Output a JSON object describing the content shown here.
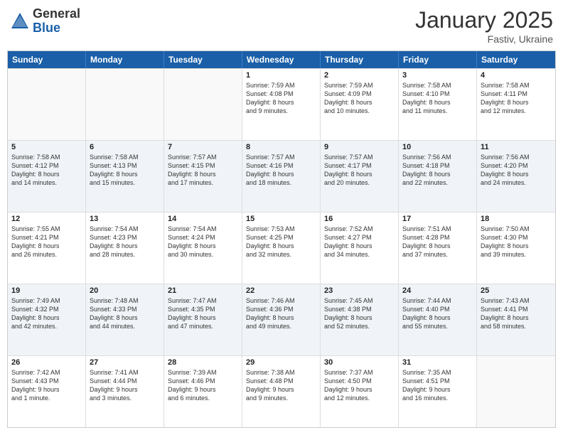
{
  "logo": {
    "general": "General",
    "blue": "Blue"
  },
  "title": "January 2025",
  "location": "Fastiv, Ukraine",
  "header_days": [
    "Sunday",
    "Monday",
    "Tuesday",
    "Wednesday",
    "Thursday",
    "Friday",
    "Saturday"
  ],
  "rows": [
    [
      {
        "day": "",
        "lines": [],
        "empty": true
      },
      {
        "day": "",
        "lines": [],
        "empty": true
      },
      {
        "day": "",
        "lines": [],
        "empty": true
      },
      {
        "day": "1",
        "lines": [
          "Sunrise: 7:59 AM",
          "Sunset: 4:08 PM",
          "Daylight: 8 hours",
          "and 9 minutes."
        ],
        "empty": false
      },
      {
        "day": "2",
        "lines": [
          "Sunrise: 7:59 AM",
          "Sunset: 4:09 PM",
          "Daylight: 8 hours",
          "and 10 minutes."
        ],
        "empty": false
      },
      {
        "day": "3",
        "lines": [
          "Sunrise: 7:58 AM",
          "Sunset: 4:10 PM",
          "Daylight: 8 hours",
          "and 11 minutes."
        ],
        "empty": false
      },
      {
        "day": "4",
        "lines": [
          "Sunrise: 7:58 AM",
          "Sunset: 4:11 PM",
          "Daylight: 8 hours",
          "and 12 minutes."
        ],
        "empty": false
      }
    ],
    [
      {
        "day": "5",
        "lines": [
          "Sunrise: 7:58 AM",
          "Sunset: 4:12 PM",
          "Daylight: 8 hours",
          "and 14 minutes."
        ],
        "empty": false
      },
      {
        "day": "6",
        "lines": [
          "Sunrise: 7:58 AM",
          "Sunset: 4:13 PM",
          "Daylight: 8 hours",
          "and 15 minutes."
        ],
        "empty": false
      },
      {
        "day": "7",
        "lines": [
          "Sunrise: 7:57 AM",
          "Sunset: 4:15 PM",
          "Daylight: 8 hours",
          "and 17 minutes."
        ],
        "empty": false
      },
      {
        "day": "8",
        "lines": [
          "Sunrise: 7:57 AM",
          "Sunset: 4:16 PM",
          "Daylight: 8 hours",
          "and 18 minutes."
        ],
        "empty": false
      },
      {
        "day": "9",
        "lines": [
          "Sunrise: 7:57 AM",
          "Sunset: 4:17 PM",
          "Daylight: 8 hours",
          "and 20 minutes."
        ],
        "empty": false
      },
      {
        "day": "10",
        "lines": [
          "Sunrise: 7:56 AM",
          "Sunset: 4:18 PM",
          "Daylight: 8 hours",
          "and 22 minutes."
        ],
        "empty": false
      },
      {
        "day": "11",
        "lines": [
          "Sunrise: 7:56 AM",
          "Sunset: 4:20 PM",
          "Daylight: 8 hours",
          "and 24 minutes."
        ],
        "empty": false
      }
    ],
    [
      {
        "day": "12",
        "lines": [
          "Sunrise: 7:55 AM",
          "Sunset: 4:21 PM",
          "Daylight: 8 hours",
          "and 26 minutes."
        ],
        "empty": false
      },
      {
        "day": "13",
        "lines": [
          "Sunrise: 7:54 AM",
          "Sunset: 4:23 PM",
          "Daylight: 8 hours",
          "and 28 minutes."
        ],
        "empty": false
      },
      {
        "day": "14",
        "lines": [
          "Sunrise: 7:54 AM",
          "Sunset: 4:24 PM",
          "Daylight: 8 hours",
          "and 30 minutes."
        ],
        "empty": false
      },
      {
        "day": "15",
        "lines": [
          "Sunrise: 7:53 AM",
          "Sunset: 4:25 PM",
          "Daylight: 8 hours",
          "and 32 minutes."
        ],
        "empty": false
      },
      {
        "day": "16",
        "lines": [
          "Sunrise: 7:52 AM",
          "Sunset: 4:27 PM",
          "Daylight: 8 hours",
          "and 34 minutes."
        ],
        "empty": false
      },
      {
        "day": "17",
        "lines": [
          "Sunrise: 7:51 AM",
          "Sunset: 4:28 PM",
          "Daylight: 8 hours",
          "and 37 minutes."
        ],
        "empty": false
      },
      {
        "day": "18",
        "lines": [
          "Sunrise: 7:50 AM",
          "Sunset: 4:30 PM",
          "Daylight: 8 hours",
          "and 39 minutes."
        ],
        "empty": false
      }
    ],
    [
      {
        "day": "19",
        "lines": [
          "Sunrise: 7:49 AM",
          "Sunset: 4:32 PM",
          "Daylight: 8 hours",
          "and 42 minutes."
        ],
        "empty": false
      },
      {
        "day": "20",
        "lines": [
          "Sunrise: 7:48 AM",
          "Sunset: 4:33 PM",
          "Daylight: 8 hours",
          "and 44 minutes."
        ],
        "empty": false
      },
      {
        "day": "21",
        "lines": [
          "Sunrise: 7:47 AM",
          "Sunset: 4:35 PM",
          "Daylight: 8 hours",
          "and 47 minutes."
        ],
        "empty": false
      },
      {
        "day": "22",
        "lines": [
          "Sunrise: 7:46 AM",
          "Sunset: 4:36 PM",
          "Daylight: 8 hours",
          "and 49 minutes."
        ],
        "empty": false
      },
      {
        "day": "23",
        "lines": [
          "Sunrise: 7:45 AM",
          "Sunset: 4:38 PM",
          "Daylight: 8 hours",
          "and 52 minutes."
        ],
        "empty": false
      },
      {
        "day": "24",
        "lines": [
          "Sunrise: 7:44 AM",
          "Sunset: 4:40 PM",
          "Daylight: 8 hours",
          "and 55 minutes."
        ],
        "empty": false
      },
      {
        "day": "25",
        "lines": [
          "Sunrise: 7:43 AM",
          "Sunset: 4:41 PM",
          "Daylight: 8 hours",
          "and 58 minutes."
        ],
        "empty": false
      }
    ],
    [
      {
        "day": "26",
        "lines": [
          "Sunrise: 7:42 AM",
          "Sunset: 4:43 PM",
          "Daylight: 9 hours",
          "and 1 minute."
        ],
        "empty": false
      },
      {
        "day": "27",
        "lines": [
          "Sunrise: 7:41 AM",
          "Sunset: 4:44 PM",
          "Daylight: 9 hours",
          "and 3 minutes."
        ],
        "empty": false
      },
      {
        "day": "28",
        "lines": [
          "Sunrise: 7:39 AM",
          "Sunset: 4:46 PM",
          "Daylight: 9 hours",
          "and 6 minutes."
        ],
        "empty": false
      },
      {
        "day": "29",
        "lines": [
          "Sunrise: 7:38 AM",
          "Sunset: 4:48 PM",
          "Daylight: 9 hours",
          "and 9 minutes."
        ],
        "empty": false
      },
      {
        "day": "30",
        "lines": [
          "Sunrise: 7:37 AM",
          "Sunset: 4:50 PM",
          "Daylight: 9 hours",
          "and 12 minutes."
        ],
        "empty": false
      },
      {
        "day": "31",
        "lines": [
          "Sunrise: 7:35 AM",
          "Sunset: 4:51 PM",
          "Daylight: 9 hours",
          "and 16 minutes."
        ],
        "empty": false
      },
      {
        "day": "",
        "lines": [],
        "empty": true
      }
    ]
  ]
}
